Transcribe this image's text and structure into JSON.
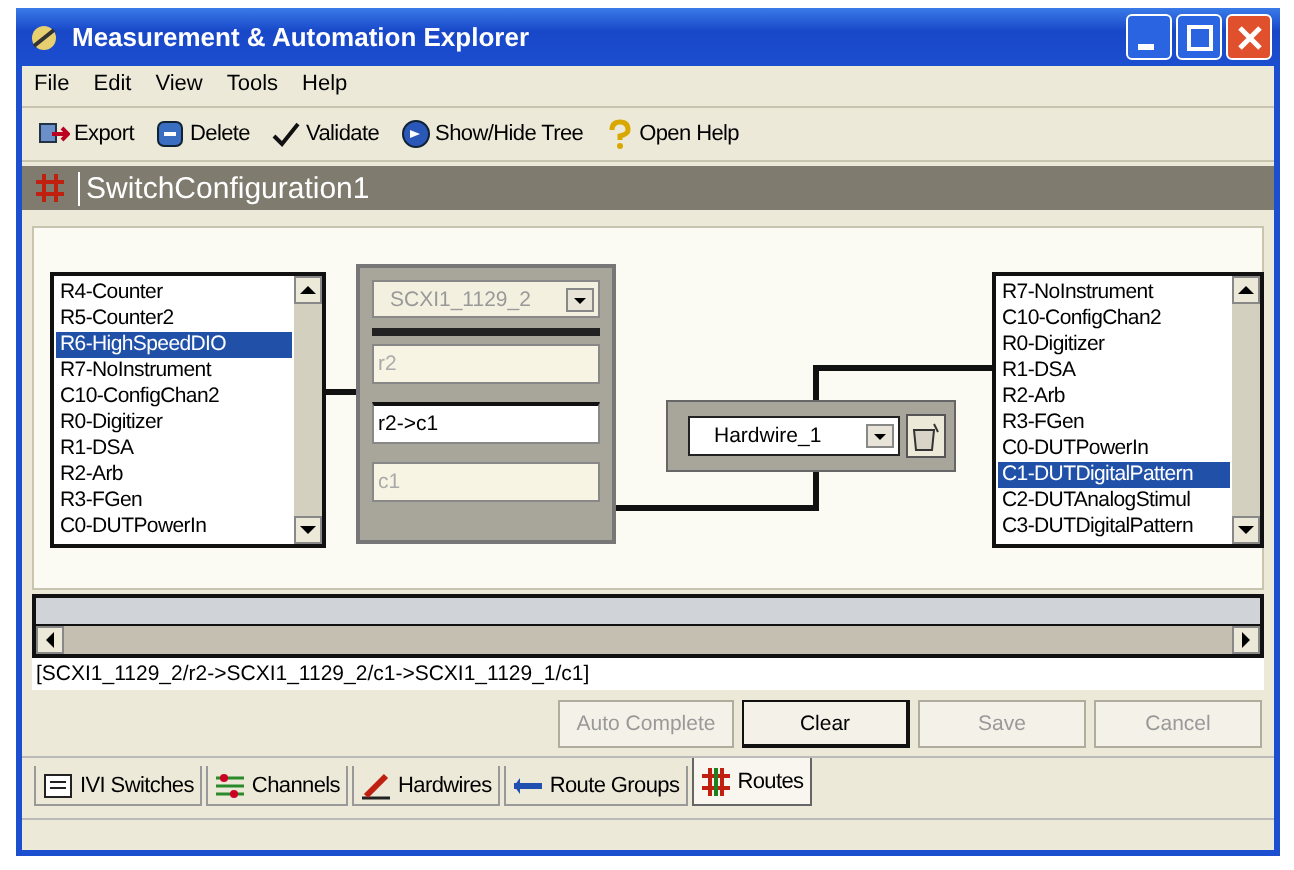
{
  "window": {
    "title": "Measurement & Automation Explorer"
  },
  "menu": [
    {
      "label": "File"
    },
    {
      "label": "Edit"
    },
    {
      "label": "View"
    },
    {
      "label": "Tools"
    },
    {
      "label": "Help"
    }
  ],
  "toolbar": [
    {
      "label": "Export",
      "kind": "export"
    },
    {
      "label": "Delete",
      "kind": "delete"
    },
    {
      "label": "Validate",
      "kind": "validate"
    },
    {
      "label": "Show/Hide Tree",
      "kind": "tree"
    },
    {
      "label": "Open Help",
      "kind": "help"
    }
  ],
  "header": {
    "title": "SwitchConfiguration1"
  },
  "left_list": {
    "items": [
      {
        "label": "R4-Counter",
        "selected": false
      },
      {
        "label": "R5-Counter2",
        "selected": false
      },
      {
        "label": "R6-HighSpeedDIO",
        "selected": true
      },
      {
        "label": "R7-NoInstrument",
        "selected": false
      },
      {
        "label": "C10-ConfigChan2",
        "selected": false
      },
      {
        "label": "R0-Digitizer",
        "selected": false
      },
      {
        "label": "R1-DSA",
        "selected": false
      },
      {
        "label": "R2-Arb",
        "selected": false
      },
      {
        "label": "R3-FGen",
        "selected": false
      },
      {
        "label": "C0-DUTPowerIn",
        "selected": false
      }
    ]
  },
  "route_panel": {
    "device": {
      "value": "SCXI1_1129_2",
      "disabled": true
    },
    "fields": [
      {
        "value": "r2",
        "disabled": true
      },
      {
        "value": "r2->c1",
        "disabled": false
      },
      {
        "value": "c1",
        "disabled": true
      }
    ]
  },
  "hardwire": {
    "value": "Hardwire_1"
  },
  "right_list": {
    "items": [
      {
        "label": "R7-NoInstrument",
        "selected": false
      },
      {
        "label": "C10-ConfigChan2",
        "selected": false
      },
      {
        "label": "R0-Digitizer",
        "selected": false
      },
      {
        "label": "R1-DSA",
        "selected": false
      },
      {
        "label": "R2-Arb",
        "selected": false
      },
      {
        "label": "R3-FGen",
        "selected": false
      },
      {
        "label": "C0-DUTPowerIn",
        "selected": false
      },
      {
        "label": "C1-DUTDigitalPattern",
        "selected": true
      },
      {
        "label": "C2-DUTAnalogStimul",
        "selected": false
      },
      {
        "label": "C3-DUTDigitalPattern",
        "selected": false
      }
    ]
  },
  "route_path": "[SCXI1_1129_2/r2->SCXI1_1129_2/c1->SCXI1_1129_1/c1]",
  "buttons": [
    {
      "label": "Auto Complete",
      "disabled": true
    },
    {
      "label": "Clear",
      "disabled": false
    },
    {
      "label": "Save",
      "disabled": true
    },
    {
      "label": "Cancel",
      "disabled": true
    }
  ],
  "tabs": [
    {
      "label": "IVI Switches",
      "kind": "switches",
      "selected": false
    },
    {
      "label": "Channels",
      "kind": "channels",
      "selected": false
    },
    {
      "label": "Hardwires",
      "kind": "hardwires",
      "selected": false
    },
    {
      "label": "Route Groups",
      "kind": "groups",
      "selected": false
    },
    {
      "label": "Routes",
      "kind": "routes",
      "selected": true
    }
  ]
}
